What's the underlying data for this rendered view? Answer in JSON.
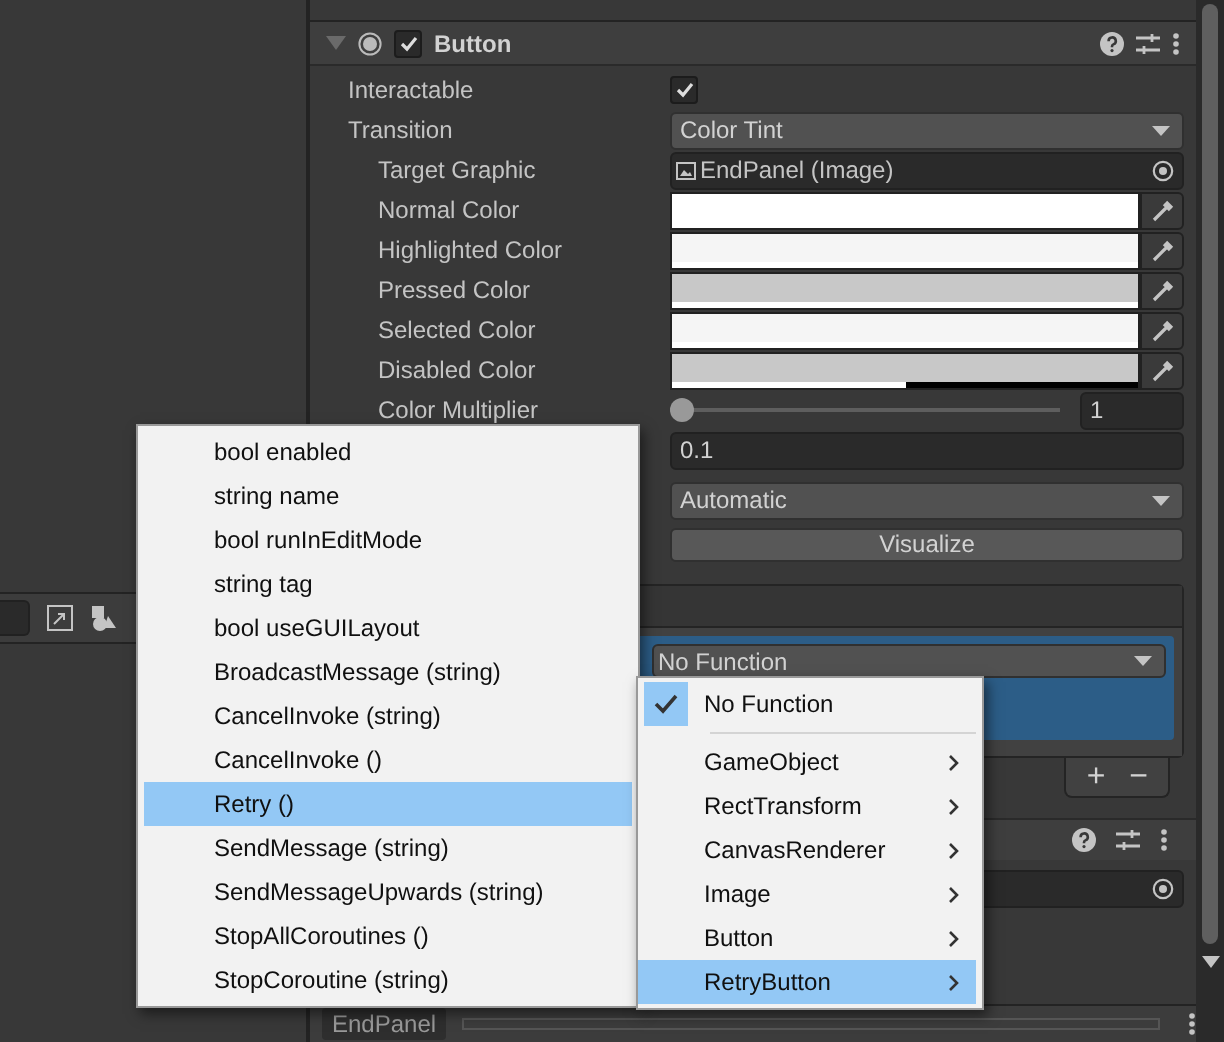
{
  "component": {
    "title": "Button",
    "enabled": true,
    "expanded": true
  },
  "fields": [
    {
      "kind": "checkbox",
      "label": "Interactable",
      "checked": true
    },
    {
      "kind": "dropdown",
      "label": "Transition",
      "value": "Color Tint"
    },
    {
      "kind": "object",
      "label": "Target Graphic",
      "value": "EndPanel (Image)"
    },
    {
      "kind": "color",
      "label": "Normal Color",
      "color": "#ffffff",
      "level": 1
    },
    {
      "kind": "color",
      "label": "Highlighted Color",
      "color": "#f5f5f5",
      "level": 1
    },
    {
      "kind": "color",
      "label": "Pressed Color",
      "color": "#c8c8c8",
      "level": 1
    },
    {
      "kind": "color",
      "label": "Selected Color",
      "color": "#f5f5f5",
      "level": 1
    },
    {
      "kind": "color",
      "label": "Disabled Color",
      "color": "#c8c8c8",
      "level": 0.5
    },
    {
      "kind": "slider",
      "label": "Color Multiplier",
      "level": 0,
      "value": "1"
    },
    {
      "kind": "number",
      "value": "0.1"
    },
    {
      "kind": "dropdown",
      "value": "Automatic"
    },
    {
      "kind": "button",
      "value": "Visualize"
    }
  ],
  "event": {
    "function": "No Function",
    "buttons": [
      "+",
      "−"
    ]
  },
  "footer": {
    "object": "EndPanel"
  },
  "method_menu": {
    "items": [
      {
        "label": "bool enabled",
        "selected": false
      },
      {
        "label": "string name",
        "selected": false
      },
      {
        "label": "bool runInEditMode",
        "selected": false
      },
      {
        "label": "string tag",
        "selected": false
      },
      {
        "label": "bool useGUILayout",
        "selected": false
      },
      {
        "label": "BroadcastMessage (string)",
        "selected": false
      },
      {
        "label": "CancelInvoke (string)",
        "selected": false
      },
      {
        "label": "CancelInvoke ()",
        "selected": false
      },
      {
        "label": "Retry ()",
        "selected": true
      },
      {
        "label": "SendMessage (string)",
        "selected": false
      },
      {
        "label": "SendMessageUpwards (string)",
        "selected": false
      },
      {
        "label": "StopAllCoroutines ()",
        "selected": false
      },
      {
        "label": "StopCoroutine (string)",
        "selected": false
      }
    ]
  },
  "component_menu": {
    "items": [
      {
        "kind": "option",
        "label": "No Function",
        "checked": true,
        "selected": false
      },
      {
        "kind": "submenu",
        "label": "GameObject",
        "selected": false
      },
      {
        "kind": "submenu",
        "label": "RectTransform",
        "selected": false
      },
      {
        "kind": "submenu",
        "label": "CanvasRenderer",
        "selected": false
      },
      {
        "kind": "submenu",
        "label": "Image",
        "selected": false
      },
      {
        "kind": "submenu",
        "label": "Button",
        "selected": false
      },
      {
        "kind": "submenu",
        "label": "RetryButton",
        "selected": true
      }
    ]
  }
}
